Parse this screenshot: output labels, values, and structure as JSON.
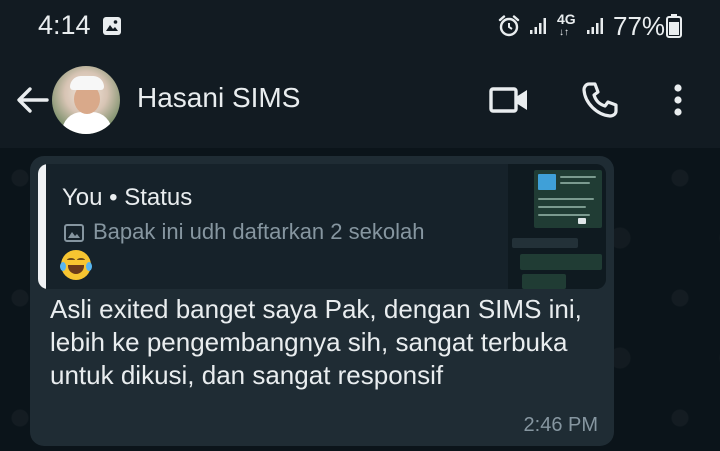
{
  "status_bar": {
    "time": "4:14",
    "network": "4G",
    "network_arrows": "↓↑",
    "battery": "77%"
  },
  "header": {
    "contact_name": "Hasani SIMS"
  },
  "icons": {
    "back": "arrow-left-icon",
    "video": "video-call-icon",
    "call": "phone-icon",
    "menu": "more-vert-icon",
    "gallery": "gallery-icon",
    "alarm": "alarm-icon",
    "signal": "signal-icon",
    "battery": "battery-icon",
    "quote_image": "image-icon"
  },
  "message": {
    "quote": {
      "author": "You • Status",
      "text": "Bapak ini udh daftarkan 2 sekolah"
    },
    "body": "Asli exited banget saya Pak, dengan SIMS ini, lebih ke pengembangnya sih, sangat terbuka untuk dikusi, dan sangat responsif",
    "time": "2:46 PM"
  },
  "colors": {
    "background": "#0b141a",
    "header": "#121b22",
    "bubble": "#1f2c34",
    "quote_bg": "#16222a",
    "secondary_text": "#8696a0"
  }
}
